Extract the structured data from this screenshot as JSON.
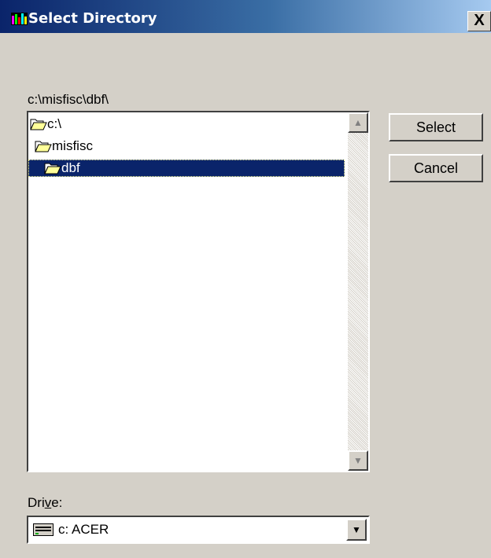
{
  "window": {
    "title": "Select Directory",
    "close_label": "X"
  },
  "current_path": "c:\\misfisc\\dbf\\",
  "directories": [
    {
      "label": "c:\\",
      "level": 0,
      "state": "open",
      "selected": false
    },
    {
      "label": "misfisc",
      "level": 1,
      "state": "open",
      "selected": false
    },
    {
      "label": "dbf",
      "level": 2,
      "state": "open",
      "selected": true
    }
  ],
  "buttons": {
    "select_label": "Select",
    "cancel_label": "Cancel"
  },
  "drive": {
    "label_before": "Dri",
    "label_accel": "v",
    "label_after": "e:",
    "value": "c: ACER",
    "icon": "hard-drive-icon"
  },
  "scrollbar": {
    "up_glyph": "▲",
    "down_glyph": "▼"
  },
  "combo": {
    "dropdown_glyph": "▼"
  },
  "colors": {
    "titlebar": "#0a246a",
    "selection": "#0a246a",
    "face": "#d4d0c8"
  }
}
